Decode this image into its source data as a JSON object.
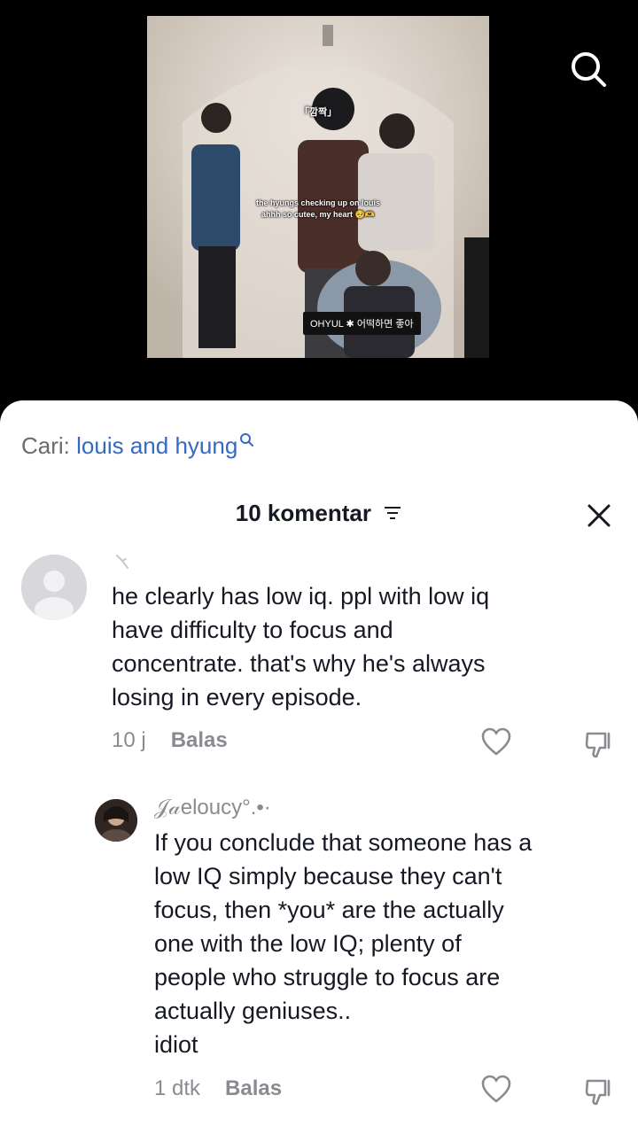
{
  "video": {
    "caption_title": "「깜짝」",
    "caption_line1": "the hyungs checking up on louis",
    "caption_line2": "ahhh so cutee, my heart 🥺🫶",
    "song_tag": "OHYUL ✱ 어떡하면 좋아",
    "search_icon": "search-icon"
  },
  "sheet": {
    "search_prefix": "Cari:",
    "search_query": "louis and hyung",
    "comment_count": "10 komentar",
    "filter_icon": "filter-icon",
    "close_icon": "close-icon"
  },
  "comments": [
    {
      "author": "",
      "text": "he clearly has low iq. ppl with low iq\nhave difficulty to focus and\nconcentrate. that's why he's always\nlosing in every episode.",
      "time": "10 j",
      "reply_label": "Balas"
    },
    {
      "author": "𝒥𝒶eloucy°.•·",
      "text": "If you conclude that someone has a\nlow IQ simply because they can't\nfocus, then *you* are the actually\none with the low IQ; plenty of\npeople who struggle to focus are\nactually geniuses..\nidiot",
      "time": "1 dtk",
      "reply_label": "Balas"
    }
  ],
  "colors": {
    "accent": "#3469c4",
    "text": "#161823",
    "muted": "#8a8b91"
  }
}
